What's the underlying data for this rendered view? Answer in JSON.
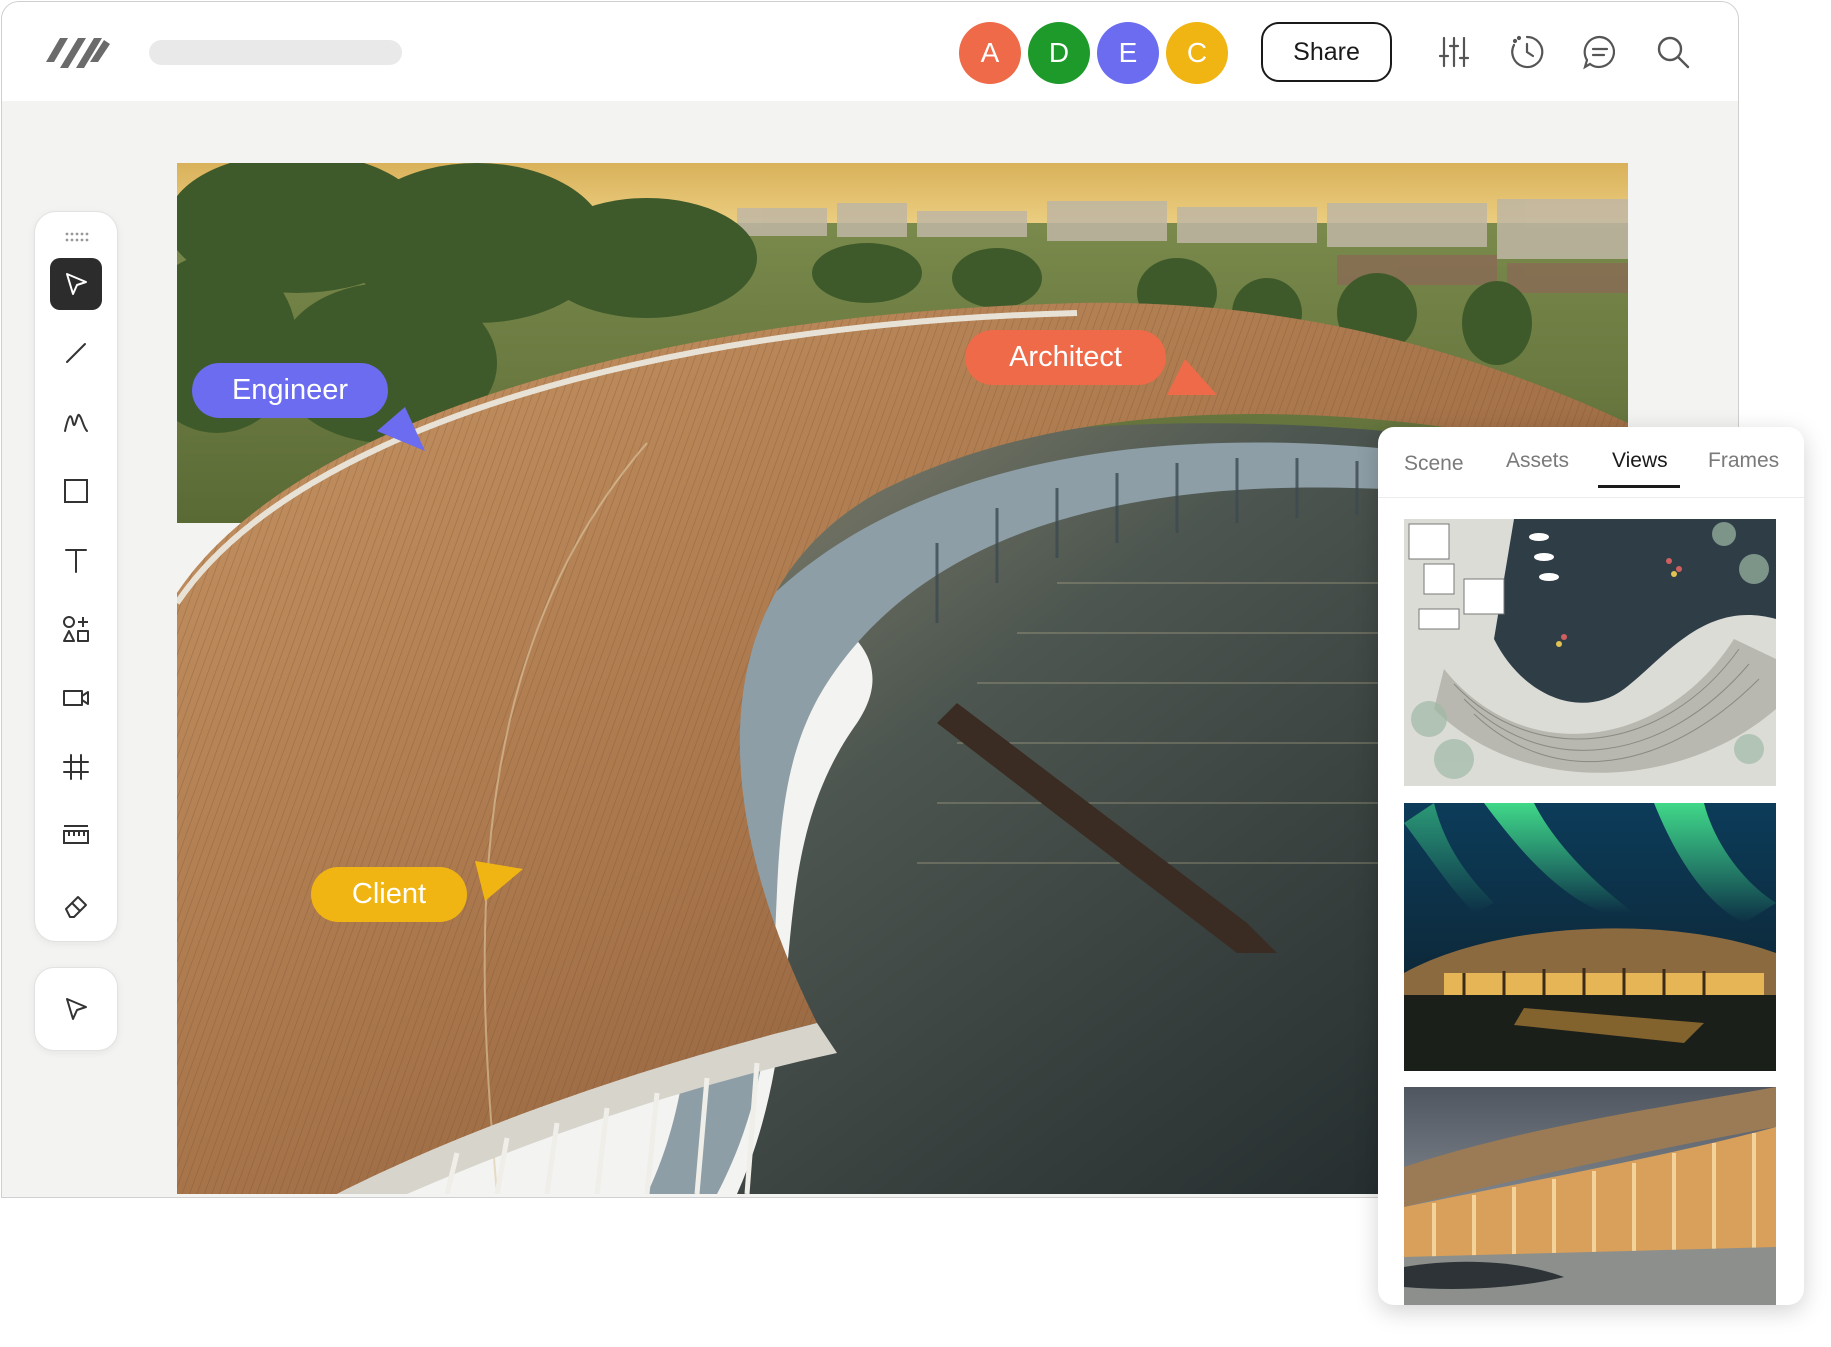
{
  "app": {
    "title": ""
  },
  "header": {
    "avatars": [
      {
        "initial": "A",
        "color": "#ee6a48"
      },
      {
        "initial": "D",
        "color": "#1d9a2a"
      },
      {
        "initial": "E",
        "color": "#6b6cf0"
      },
      {
        "initial": "C",
        "color": "#f0b512"
      }
    ],
    "share_label": "Share",
    "icons": [
      "sliders-icon",
      "history-icon",
      "comment-icon",
      "search-icon"
    ]
  },
  "toolbar": {
    "tools": [
      "select-tool",
      "line-tool",
      "pen-tool",
      "rectangle-tool",
      "text-tool",
      "shapes-tool",
      "video-tool",
      "grid-tool",
      "ruler-tool",
      "eraser-tool"
    ],
    "active_tool": "select-tool",
    "secondary_tool": "navigate-tool"
  },
  "collaborators": {
    "engineer": {
      "label": "Engineer",
      "color": "#6b6cf0"
    },
    "architect": {
      "label": "Architect",
      "color": "#ee6a48"
    },
    "client": {
      "label": "Client",
      "color": "#f0b512"
    }
  },
  "panel": {
    "tabs": [
      "Scene",
      "Assets",
      "Views",
      "Frames"
    ],
    "active_tab": "Views",
    "thumbnails": [
      "site-plan-thumbnail",
      "aurora-night-thumbnail",
      "colonnade-thumbnail"
    ]
  }
}
